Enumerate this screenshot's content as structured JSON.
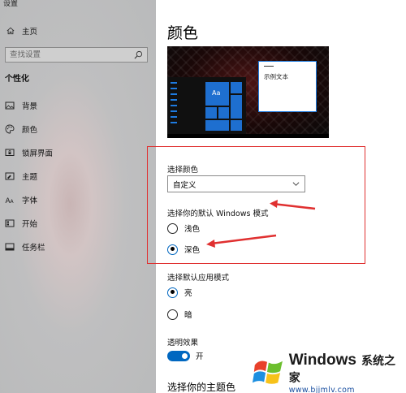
{
  "app_title": "设置",
  "sidebar": {
    "home_label": "主页",
    "search_placeholder": "查找设置",
    "section_title": "个性化",
    "items": [
      {
        "label": "背景",
        "icon": "image-icon"
      },
      {
        "label": "颜色",
        "icon": "palette-icon"
      },
      {
        "label": "锁屏界面",
        "icon": "lock-screen-icon"
      },
      {
        "label": "主题",
        "icon": "theme-icon"
      },
      {
        "label": "字体",
        "icon": "font-icon"
      },
      {
        "label": "开始",
        "icon": "start-icon"
      },
      {
        "label": "任务栏",
        "icon": "taskbar-icon"
      }
    ]
  },
  "main": {
    "page_title": "颜色",
    "preview": {
      "tile_text": "Aa",
      "sample_text": "示例文本"
    },
    "choose_color": {
      "label": "选择颜色",
      "value": "自定义"
    },
    "windows_mode": {
      "label": "选择你的默认 Windows 模式",
      "options": [
        {
          "label": "浅色",
          "selected": false
        },
        {
          "label": "深色",
          "selected": true
        }
      ]
    },
    "app_mode": {
      "label": "选择默认应用模式",
      "options": [
        {
          "label": "亮",
          "selected": true
        },
        {
          "label": "暗",
          "selected": false
        }
      ]
    },
    "transparency": {
      "label": "透明效果",
      "state": "开",
      "on": true
    },
    "accent_heading": "选择你的主题色"
  },
  "watermark": {
    "brand": "Windows",
    "brand_cn": "系统之家",
    "url": "www.bjjmlv.com"
  },
  "colors": {
    "accent": "#0067c0",
    "annotation": "#e03030"
  }
}
